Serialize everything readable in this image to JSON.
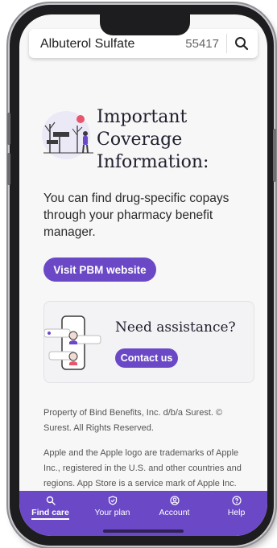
{
  "search": {
    "drug": "Albuterol Sulfate",
    "zip": "55417"
  },
  "coverage": {
    "title_line1": "Important",
    "title_line2": "Coverage",
    "title_line3": "Information:",
    "body": "You can find drug-specific copays through your pharmacy benefit manager.",
    "button_label": "Visit PBM website"
  },
  "assistance": {
    "title": "Need assistance?",
    "button_label": "Contact us"
  },
  "legal": {
    "paragraph1": "Property of Bind Benefits, Inc. d/b/a Surest. © Surest. All Rights Reserved.",
    "paragraph2": "Apple and the Apple logo are trademarks of Apple Inc., registered in the U.S. and other countries and regions. App Store is a service mark of Apple Inc."
  },
  "nav": {
    "items": [
      {
        "label": "Find care",
        "icon": "search-icon",
        "active": true
      },
      {
        "label": "Your plan",
        "icon": "shield-icon",
        "active": false
      },
      {
        "label": "Account",
        "icon": "user-circle-icon",
        "active": false
      },
      {
        "label": "Help",
        "icon": "help-icon",
        "active": false
      }
    ]
  },
  "colors": {
    "accent": "#6b49c6",
    "background": "#f7f7f7"
  }
}
